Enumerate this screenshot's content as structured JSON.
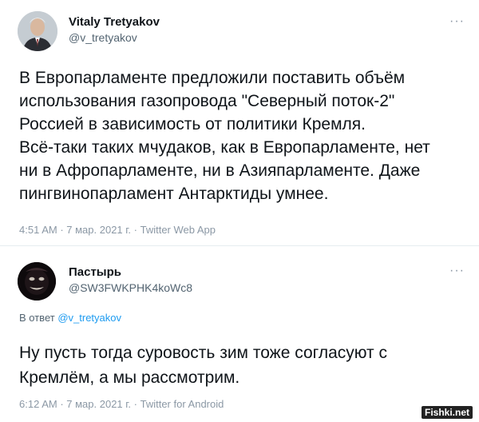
{
  "tweet1": {
    "author_name": "Vitaly Tretyakov",
    "handle": "@v_tretyakov",
    "text": "В Европарламенте предложили поставить объём\nиспользования газопровода \"Северный поток-2\"\nРоссией в зависимость от политики Кремля.\nВсё-таки таких мчудаков, как в Европарламенте, нет\nни в Афропарламенте, ни в Азияпарламенте. Даже\nпингвинопарламент Антарктиды умнее.",
    "time": "4:51 AM",
    "date": "7 мар. 2021 г.",
    "source": "Twitter Web App",
    "more_icon": "more-dots-icon"
  },
  "tweet2": {
    "author_name": "Пастырь",
    "handle": "@SW3FWKPHK4koWc8",
    "reply_prefix": "В ответ",
    "reply_handle": "@v_tretyakov",
    "text": "Ну пусть тогда суровость зим тоже согласуют с\nКремлём, а мы рассмотрим.",
    "time": "6:12 AM",
    "date": "7 мар. 2021 г.",
    "source": "Twitter for Android",
    "more_icon": "more-dots-icon"
  },
  "watermark": "Fishki.net",
  "colors": {
    "link": "#1d9bf0",
    "secondary": "#536471",
    "meta": "#8b98a5",
    "divider": "#e6ecf0"
  },
  "separator": " · "
}
